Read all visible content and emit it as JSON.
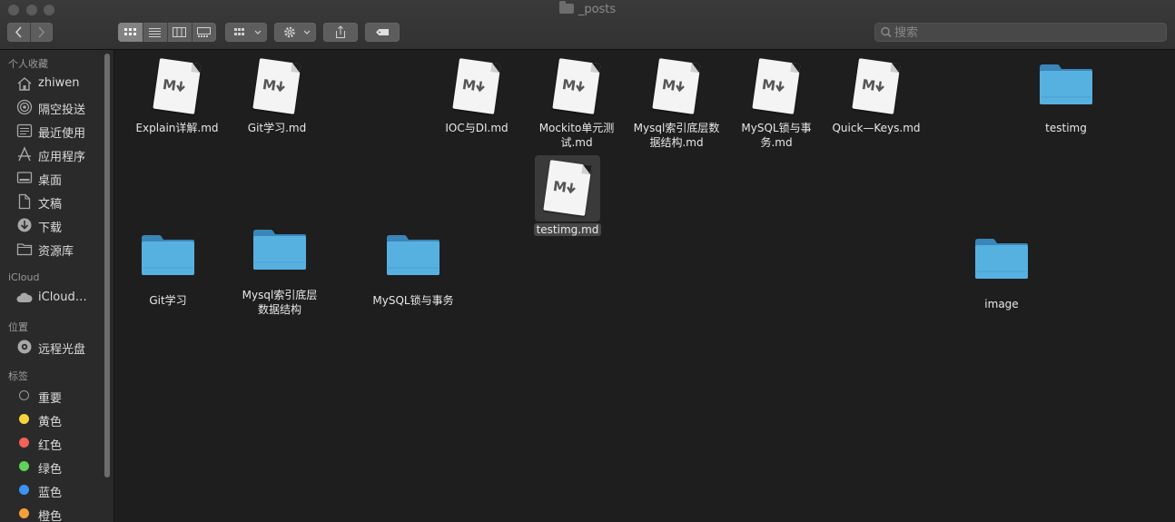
{
  "window": {
    "title": "_posts"
  },
  "toolbar": {
    "buttons": [
      "back-icon",
      "forward-icon",
      "icon-view-icon",
      "list-view-icon",
      "column-view-icon",
      "gallery-view-icon",
      "group-icon",
      "action-gear-icon",
      "share-icon",
      "tag-icon"
    ],
    "search_placeholder": "搜索"
  },
  "sidebar": {
    "favorites_title": "个人收藏",
    "favorites": [
      {
        "label": "zhiwen",
        "icon": "home-icon"
      },
      {
        "label": "隔空投送",
        "icon": "airdrop-icon"
      },
      {
        "label": "最近使用",
        "icon": "recents-icon"
      },
      {
        "label": "应用程序",
        "icon": "applications-icon"
      },
      {
        "label": "桌面",
        "icon": "desktop-icon"
      },
      {
        "label": "文稿",
        "icon": "documents-icon"
      },
      {
        "label": "下载",
        "icon": "downloads-icon"
      },
      {
        "label": "资源库",
        "icon": "library-folder-icon"
      }
    ],
    "icloud_title": "iCloud",
    "icloud": [
      {
        "label": "iCloud…",
        "icon": "cloud-icon"
      }
    ],
    "locations_title": "位置",
    "locations": [
      {
        "label": "远程光盘",
        "icon": "disc-icon"
      }
    ],
    "tags_title": "标签",
    "tags": [
      {
        "label": "重要",
        "color": "#3a3a3a"
      },
      {
        "label": "黄色",
        "color": "#f5d33f"
      },
      {
        "label": "红色",
        "color": "#f2615a"
      },
      {
        "label": "绿色",
        "color": "#5fd25a"
      },
      {
        "label": "蓝色",
        "color": "#3d93f5"
      },
      {
        "label": "橙色",
        "color": "#f5a03a"
      }
    ]
  },
  "files": [
    {
      "name": "Explain详解.md",
      "type": "markdown"
    },
    {
      "name": "Git学习.md",
      "type": "markdown"
    },
    {
      "name": "IOC与DI.md",
      "type": "markdown"
    },
    {
      "name": "Mockito单元测试.md",
      "name_line1": "Mockito单元测",
      "name_line2": "试.md",
      "type": "markdown"
    },
    {
      "name": "Mysql索引底层数据结构.md",
      "name_line1": "Mysql索引底层数",
      "name_line2": "据结构.md",
      "type": "markdown"
    },
    {
      "name": "MySQL锁与事务.md",
      "name_line1": "MySQL锁与事",
      "name_line2": "务.md",
      "type": "markdown"
    },
    {
      "name": "Quick—Keys.md",
      "type": "markdown"
    },
    {
      "name": "testimg",
      "type": "folder"
    },
    {
      "name": "testimg.md",
      "type": "markdown",
      "selected": true
    },
    {
      "name": "Git学习",
      "type": "folder"
    },
    {
      "name": "Mysql索引底层数据结构",
      "name_line1": "Mysql索引底层",
      "name_line2": "数据结构",
      "type": "folder"
    },
    {
      "name": "MySQL锁与事务",
      "type": "folder"
    },
    {
      "name": "image",
      "type": "folder"
    }
  ],
  "colors": {
    "folder_blue": "#4fa8d8",
    "background": "#1e1e1e",
    "sidebar": "#2a2a2a"
  }
}
